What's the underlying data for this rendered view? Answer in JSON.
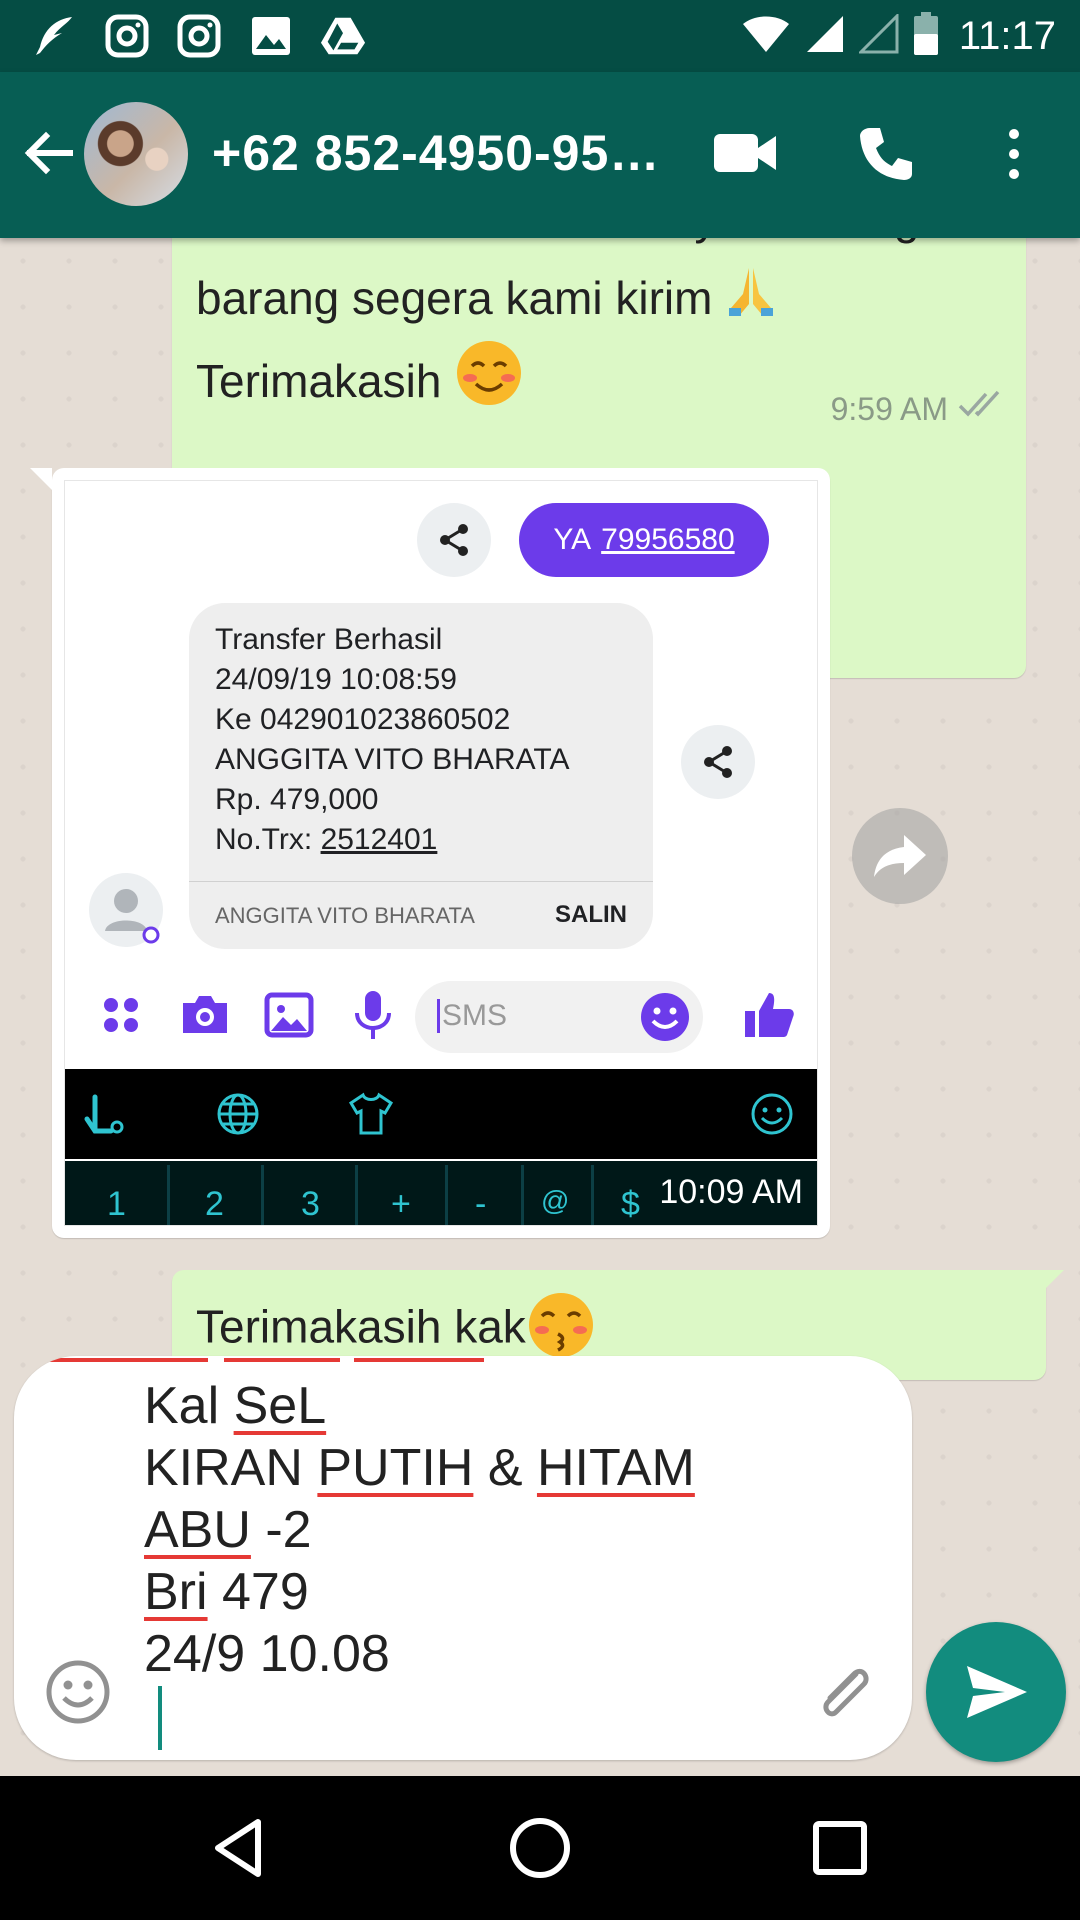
{
  "status_bar": {
    "time": "11:17",
    "left_icons": [
      "feather-icon",
      "instagram-icon",
      "instagram-icon",
      "image-icon",
      "drive-icon"
    ],
    "right_icons": [
      "wifi-icon",
      "signal-icon",
      "signal-empty-icon",
      "battery-icon"
    ]
  },
  "toolbar": {
    "contact_name": "+62 852-4950-95…",
    "icons": [
      "back-arrow-icon",
      "video-call-icon",
      "phone-call-icon",
      "more-vert-icon"
    ]
  },
  "messages": {
    "first": {
      "line1": "kirim bukti transfer ke saya kak?  Agar",
      "line2": "barang segera kami kirim",
      "line3": "Terimakasih",
      "time": "9:59 AM",
      "status": "read"
    },
    "screenshot": {
      "reply_label": "YA",
      "reply_number": "79956580",
      "sms_lines": [
        "Transfer Berhasil",
        "24/09/19 10:08:59",
        "Ke 042901023860502",
        "ANGGITA VITO BHARATA",
        "Rp. 479,000",
        "No.Trx: "
      ],
      "trx_number": "2512401",
      "sms_from": "ANGGITA VITO BHARATA",
      "copy_label": "SALIN",
      "sms_placeholder": "SMS",
      "keyboard_keys": [
        "1",
        "2",
        "3",
        "+",
        "-",
        "@",
        "$"
      ],
      "keyboard_time": "10:09 AM",
      "accent_color": "#6c3bea"
    },
    "last": {
      "text": "Terimakasih kak"
    }
  },
  "composer": {
    "lines": [
      "Kal SeL",
      "KIRAN PUTIH & HITAM",
      "ABU -2",
      "Bri 479",
      "24/9 10.08"
    ]
  },
  "colors": {
    "header": "#075e54",
    "status_bar": "#054d44",
    "outgoing_bubble": "#dcf8c6",
    "send_button": "#128c7e"
  },
  "nav_bar": {
    "icons": [
      "back-triangle-icon",
      "home-circle-icon",
      "recents-square-icon"
    ]
  }
}
